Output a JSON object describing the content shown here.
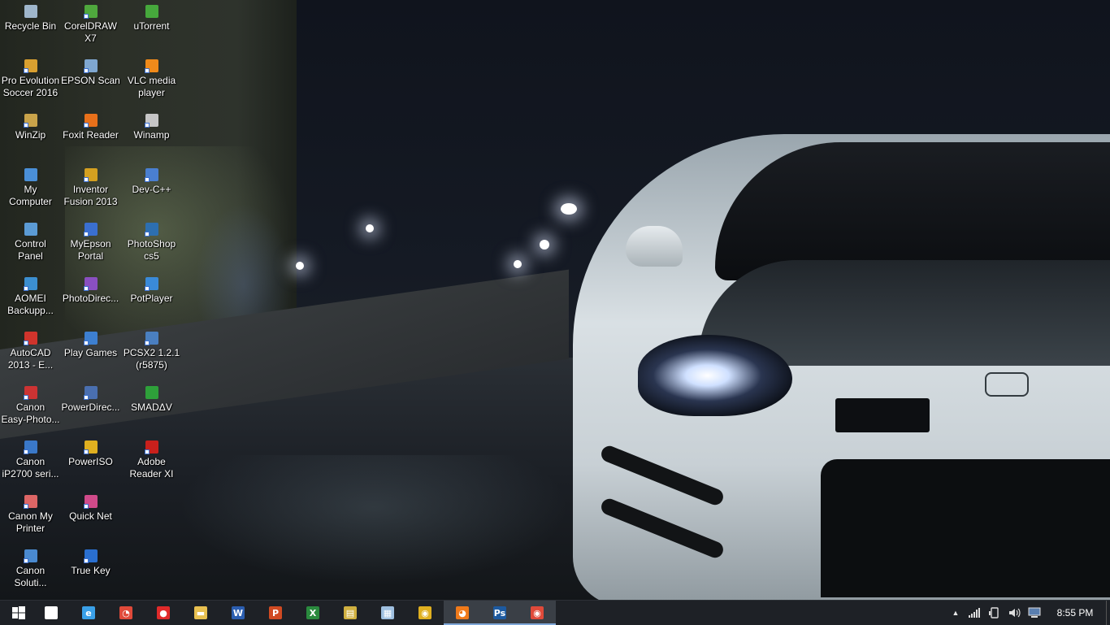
{
  "desktop": {
    "icons": [
      {
        "label": "Recycle Bin",
        "icon": "recycle-bin-icon",
        "color": "#9fb6cc",
        "shortcut": false
      },
      {
        "label": "Pro Evolution\nSoccer 2016",
        "icon": "pes-icon",
        "color": "#d9a030",
        "shortcut": true
      },
      {
        "label": "WinZip",
        "icon": "winzip-icon",
        "color": "#c9a34a",
        "shortcut": true
      },
      {
        "label": "My\nComputer",
        "icon": "computer-icon",
        "color": "#4a8fd8",
        "shortcut": false
      },
      {
        "label": "Control\nPanel",
        "icon": "control-panel-icon",
        "color": "#5b9bd5",
        "shortcut": false
      },
      {
        "label": "AOMEI\nBackupp...",
        "icon": "aomei-icon",
        "color": "#3c8fd0",
        "shortcut": true
      },
      {
        "label": "AutoCAD\n2013 - E...",
        "icon": "autocad-icon",
        "color": "#d0342c",
        "shortcut": true
      },
      {
        "label": "Canon\nEasy-Photo...",
        "icon": "canon-icon",
        "color": "#c33",
        "shortcut": true
      },
      {
        "label": "Canon\niP2700 seri...",
        "icon": "canon-icon",
        "color": "#3a78c8",
        "shortcut": true
      },
      {
        "label": "Canon My\nPrinter",
        "icon": "canon-icon",
        "color": "#d66",
        "shortcut": true
      },
      {
        "label": "Canon\nSoluti...",
        "icon": "canon-icon",
        "color": "#4a8ad0",
        "shortcut": true
      },
      {
        "label": "CorelDRAW\nX7",
        "icon": "coreldraw-icon",
        "color": "#4fa83d",
        "shortcut": true
      },
      {
        "label": "EPSON Scan",
        "icon": "epson-icon",
        "color": "#7fa7d0",
        "shortcut": true
      },
      {
        "label": "Foxit Reader",
        "icon": "foxit-icon",
        "color": "#e8701a",
        "shortcut": true
      },
      {
        "label": "Inventor\nFusion 2013",
        "icon": "inventor-icon",
        "color": "#d4a020",
        "shortcut": true
      },
      {
        "label": "MyEpson\nPortal",
        "icon": "myepson-icon",
        "color": "#3a6fd0",
        "shortcut": true
      },
      {
        "label": "PhotoDirec...",
        "icon": "photodirector-icon",
        "color": "#8a4fc0",
        "shortcut": true
      },
      {
        "label": "Play Games",
        "icon": "play-games-icon",
        "color": "#3d7fd0",
        "shortcut": true
      },
      {
        "label": "PowerDirec...",
        "icon": "powerdirector-icon",
        "color": "#4a6fb0",
        "shortcut": true
      },
      {
        "label": "PowerISO",
        "icon": "poweriso-icon",
        "color": "#e0b020",
        "shortcut": true
      },
      {
        "label": "Quick Net",
        "icon": "quicknet-icon",
        "color": "#d04a8a",
        "shortcut": true
      },
      {
        "label": "True Key",
        "icon": "truekey-icon",
        "color": "#2a6fd0",
        "shortcut": true
      },
      {
        "label": "uTorrent",
        "icon": "utorrent-icon",
        "color": "#46a83c",
        "shortcut": false
      },
      {
        "label": "VLC media\nplayer",
        "icon": "vlc-icon",
        "color": "#f08a1a",
        "shortcut": true
      },
      {
        "label": "Winamp",
        "icon": "winamp-icon",
        "color": "#c6c6c6",
        "shortcut": true
      },
      {
        "label": "Dev-C++",
        "icon": "devcpp-icon",
        "color": "#4a7fd0",
        "shortcut": true
      },
      {
        "label": "PhotoShop\ncs5",
        "icon": "photoshop-icon",
        "color": "#2d6fb0",
        "shortcut": true
      },
      {
        "label": "PotPlayer",
        "icon": "potplayer-icon",
        "color": "#3a8ad8",
        "shortcut": true
      },
      {
        "label": "PCSX2 1.2.1\n(r5875)",
        "icon": "pcsx2-icon",
        "color": "#4a7fc0",
        "shortcut": true
      },
      {
        "label": "SMADΔV",
        "icon": "smadav-icon",
        "color": "#2ea03a",
        "shortcut": false
      },
      {
        "label": "Adobe\nReader XI",
        "icon": "adobe-reader-icon",
        "color": "#c8201c",
        "shortcut": true
      }
    ]
  },
  "taskbar": {
    "start_icon": "windows-start-icon",
    "pinned": [
      {
        "name": "home-icon",
        "glyph": "⌂",
        "color": "#ffffff",
        "active": false
      },
      {
        "name": "internet-explorer-icon",
        "glyph": "e",
        "color": "#3aa0e8",
        "active": false
      },
      {
        "name": "speedometer-app-icon",
        "glyph": "◔",
        "color": "#e04a3a",
        "active": false
      },
      {
        "name": "record-icon",
        "glyph": "●",
        "color": "#e02a2a",
        "active": false
      },
      {
        "name": "file-explorer-icon",
        "glyph": "▬",
        "color": "#e8c050",
        "active": false
      },
      {
        "name": "word-icon",
        "glyph": "W",
        "color": "#2b5eb0",
        "active": false
      },
      {
        "name": "powerpoint-icon",
        "glyph": "P",
        "color": "#d04a22",
        "active": false
      },
      {
        "name": "excel-icon",
        "glyph": "X",
        "color": "#2a8a3e",
        "active": false
      },
      {
        "name": "winzip-taskbar-icon",
        "glyph": "▤",
        "color": "#d0b040",
        "active": false
      },
      {
        "name": "notepad-icon",
        "glyph": "▦",
        "color": "#9fc0e0",
        "active": false
      },
      {
        "name": "chrome-icon",
        "glyph": "◉",
        "color": "#e0b020",
        "active": false
      },
      {
        "name": "firefox-icon",
        "glyph": "◕",
        "color": "#f07a1a",
        "active": true
      },
      {
        "name": "photoshop-taskbar-icon",
        "glyph": "Ps",
        "color": "#1d5aa0",
        "active": true
      },
      {
        "name": "chrome-open-icon",
        "glyph": "◉",
        "color": "#e04a3a",
        "active": true
      }
    ],
    "tray": {
      "chevron": "▲",
      "network": "signal-bars-icon",
      "device": "device-icon",
      "volume": "speaker-icon",
      "notifications": "screen-icon"
    },
    "clock": "8:55 PM"
  }
}
